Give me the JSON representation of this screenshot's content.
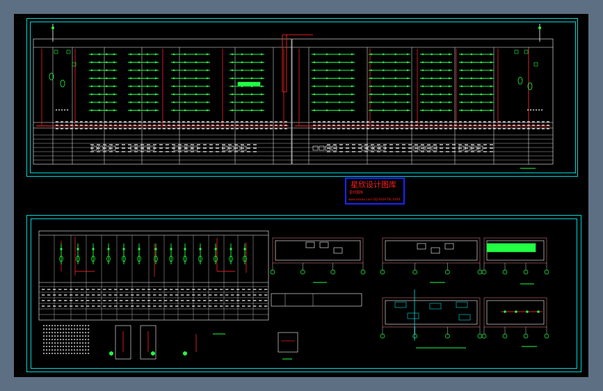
{
  "viewport": {
    "background": "#000000",
    "outer_background": "#5d6f82"
  },
  "colors": {
    "frame": "#00d8d8",
    "table_lines": "#ffffff",
    "bus": "#e02020",
    "device": "#22ff44",
    "accent_cyan": "#00e0e0",
    "watermark_border": "#1a24ff",
    "watermark_text": "#ff2020"
  },
  "watermark": {
    "title": "星欣设计图库",
    "subtitle": "星欣图库",
    "contact": "www.xxtuku.com  QQ:XXXX  TEL:XXXX"
  },
  "sheets": [
    {
      "id": "top-sheet",
      "content": "low-voltage-switchgear-system-diagram"
    },
    {
      "id": "bottom-sheet",
      "content": "high-voltage-system-diagram-and-substation-layouts"
    }
  ]
}
